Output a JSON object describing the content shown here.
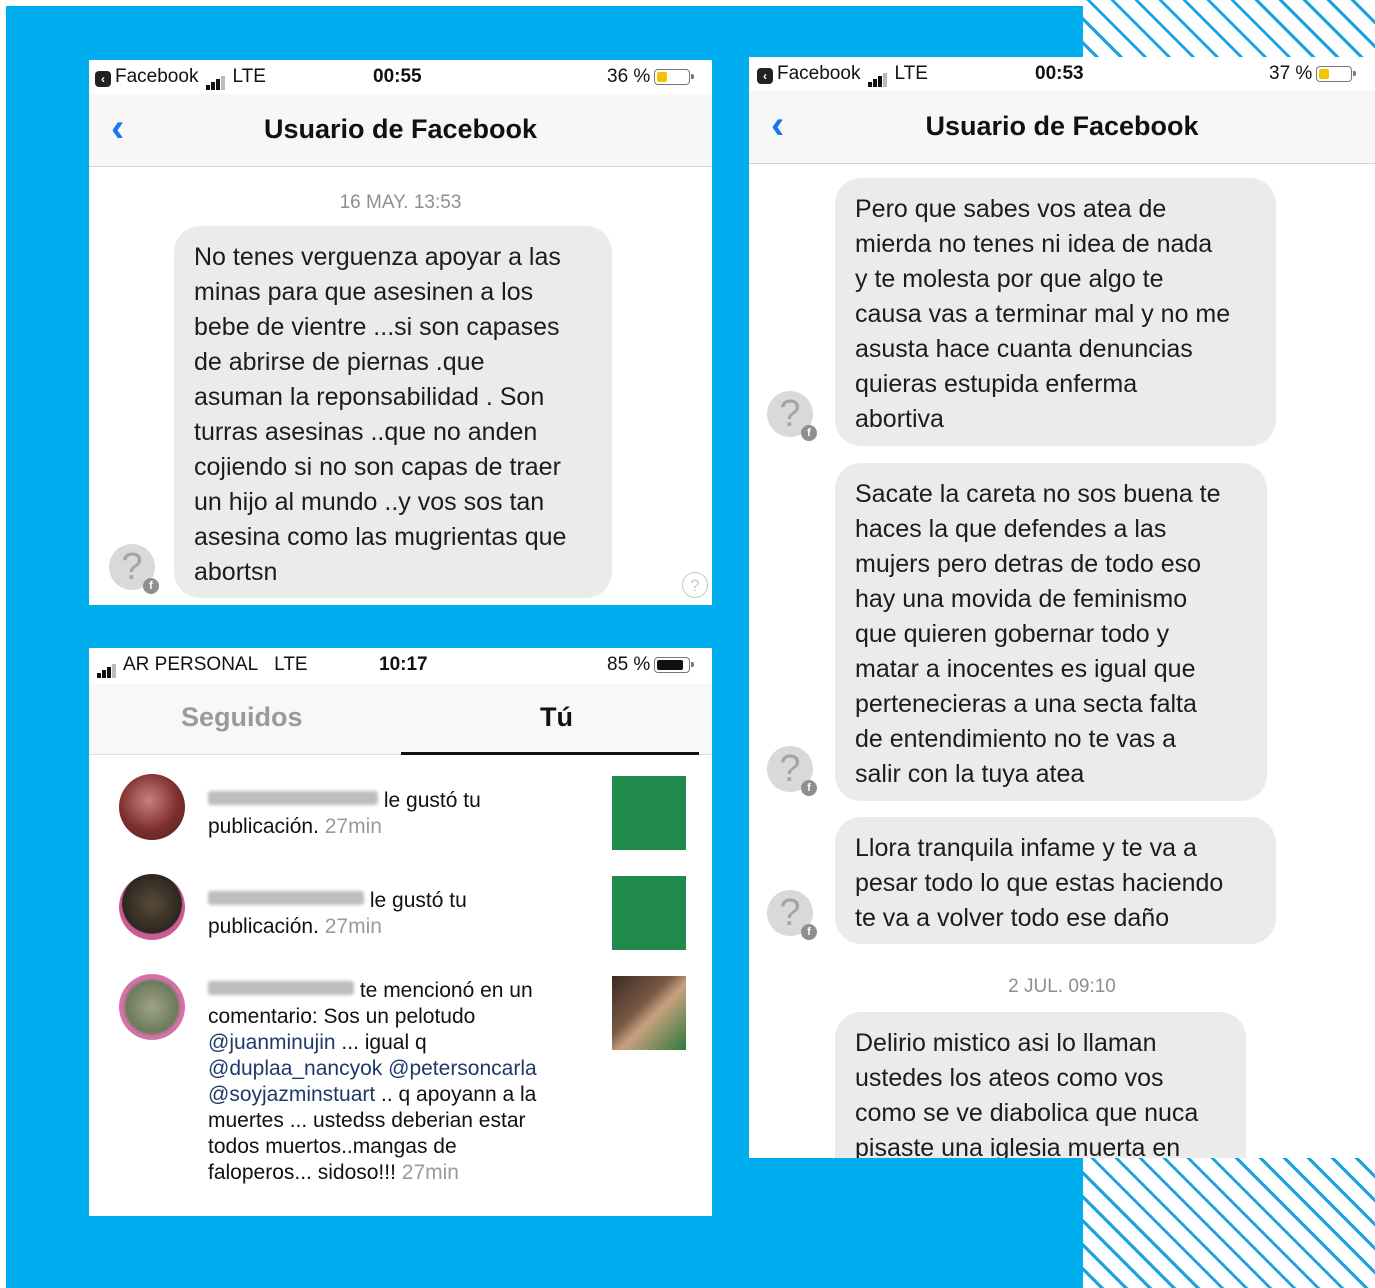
{
  "screen1": {
    "status": {
      "app": "Facebook",
      "network": "LTE",
      "time": "00:55",
      "battery": "36 %"
    },
    "header": {
      "back_icon": "chevron-left-icon",
      "title": "Usuario de Facebook"
    },
    "timestamp": "16 MAY. 13:53",
    "messages": [
      {
        "text": "No tenes verguenza apoyar a las\nminas para que asesinen a los\nbebe de vientre ...si son capases\nde abrirse de piernas .que\nasuman la reponsabilidad . Son\nturras asesinas ..que no anden\ncojiendo si no son capas de traer\nun hijo al mundo ..y vos sos tan\nasesina como las mugrientas que\nabortsn"
      }
    ]
  },
  "screen2": {
    "status": {
      "carrier": "AR PERSONAL",
      "network": "LTE",
      "time": "10:17",
      "battery": "85 %"
    },
    "tabs": [
      {
        "label": "Seguidos"
      },
      {
        "label": "Tú"
      }
    ],
    "notifications": [
      {
        "action": "le gustó tu",
        "action2": "publicación.",
        "time": "27min"
      },
      {
        "action": "le gustó tu",
        "action2": "publicación.",
        "time": "27min"
      },
      {
        "action": "te mencionó en un",
        "comment_intro": "comentario: Sos un pelotudo",
        "mention1": "@juanminujin",
        "text1": " ... igual q",
        "mention2": "@duplaa_nancyok",
        "mention3": "@petersoncarla",
        "mention4": "@soyjazminstuart",
        "text2": " .. q apoyann a la",
        "text3": "muertes ... ustedss deberian estar",
        "text4": "todos muertos..mangas de",
        "text5": "faloperos... sidoso!!! ",
        "time": "27min"
      }
    ]
  },
  "screen3": {
    "status": {
      "app": "Facebook",
      "network": "LTE",
      "time": "00:53",
      "battery": "37 %"
    },
    "header": {
      "back_icon": "chevron-left-icon",
      "title": "Usuario de Facebook"
    },
    "messages": [
      {
        "text": "Pero que sabes vos atea  de\nmierda no tenes ni idea de nada\ny te molesta por que algo te\ncausa vas a terminar mal y no me\nasusta hace cuanta denuncias\nquieras estupida enferma\nabortiva"
      },
      {
        "text": "Sacate la careta no sos buena te\nhaces la que defendes a las\nmujers pero detras de todo eso\nhay una movida de feminismo\nque quieren gobernar todo y\nmatar a inocentes es igual que\npertenecieras a una secta falta\nde entendimiento no te vas a\nsalir con la tuya atea"
      },
      {
        "text": "Llora tranquila infame y te va a\npesar todo lo que estas haciendo\nte va a volver todo ese daño"
      }
    ],
    "timestamp": "2 JUL. 09:10",
    "last_message": {
      "text": "Delirio mistico asi lo llaman\nustedes los ateos como vos\ncomo se ve diabolica que nuca\npisaste una iglesia muerta en"
    }
  },
  "colors": {
    "background_blue": "#00aeef",
    "bubble": "#ebebeb",
    "link": "#1877f2",
    "battery_yellow": "#f5c400"
  }
}
